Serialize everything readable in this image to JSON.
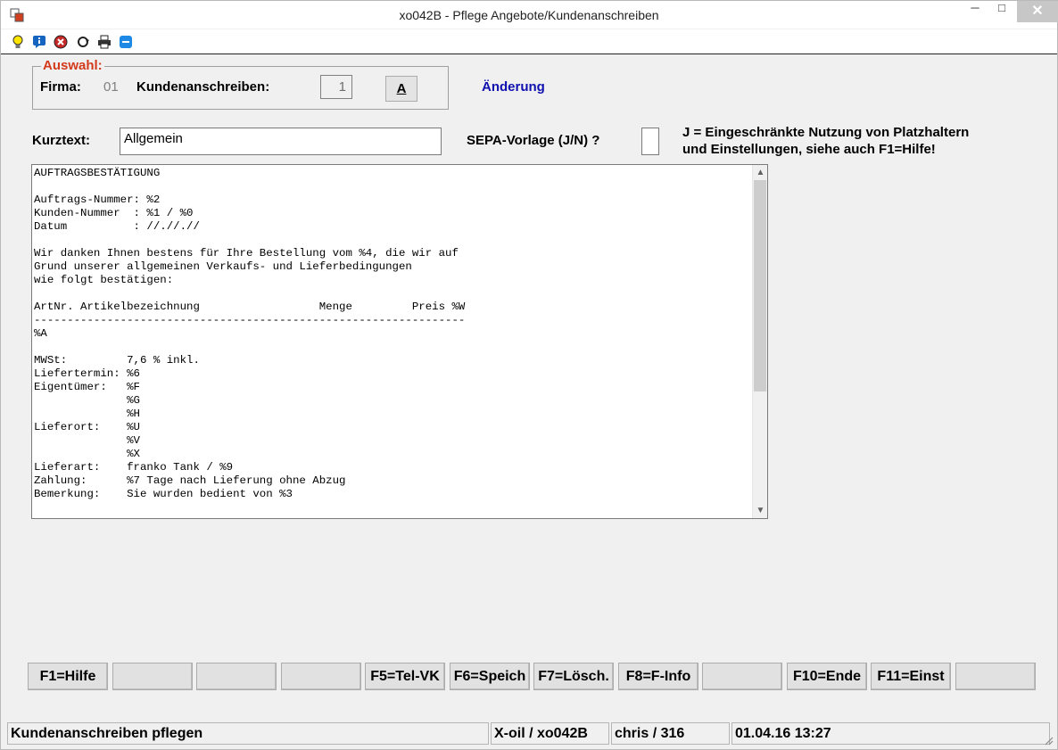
{
  "window": {
    "title": "xo042B - Pflege Angebote/Kundenanschreiben",
    "minimize_glyph": "─",
    "maximize_glyph": "□",
    "close_glyph": "✕"
  },
  "toolbar_icons": [
    "lightbulb-icon",
    "info-icon",
    "cancel-icon",
    "refresh-icon",
    "print-icon",
    "minus-icon"
  ],
  "selection": {
    "legend": "Auswahl:",
    "firma_label": "Firma:",
    "firma_value": "01",
    "kundenanschreiben_label": "Kundenanschreiben:",
    "kundenanschreiben_value": "1",
    "a_button": "A",
    "mode": "Änderung"
  },
  "form": {
    "kurztext_label": "Kurztext:",
    "kurztext_value": "Allgemein",
    "sepa_label": "SEPA-Vorlage (J/N) ?",
    "sepa_value": "",
    "note_line1": "J = Eingeschränkte Nutzung von Platzhaltern",
    "note_line2": "und Einstellungen, siehe auch F1=Hilfe!"
  },
  "letter_text": "AUFTRAGSBESTÄTIGUNG\n\nAuftrags-Nummer: %2\nKunden-Nummer  : %1 / %0\nDatum          : //.//.//\n\nWir danken Ihnen bestens für Ihre Bestellung vom %4, die wir auf\nGrund unserer allgemeinen Verkaufs- und Lieferbedingungen\nwie folgt bestätigen:\n\nArtNr. Artikelbezeichnung                  Menge         Preis %W\n-----------------------------------------------------------------\n%A\n\nMWSt:         7,6 % inkl.\nLiefertermin: %6\nEigentümer:   %F\n              %G\n              %H\nLieferort:    %U\n              %V\n              %X\nLieferart:    franko Tank / %9\nZahlung:      %7 Tage nach Lieferung ohne Abzug\nBemerkung:    Sie wurden bedient von %3",
  "function_keys": [
    {
      "label": "F1=Hilfe"
    },
    {
      "label": ""
    },
    {
      "label": ""
    },
    {
      "label": ""
    },
    {
      "label": "F5=Tel-VK"
    },
    {
      "label": "F6=Speich"
    },
    {
      "label": "F7=Lösch."
    },
    {
      "label": "F8=F-Info"
    },
    {
      "label": ""
    },
    {
      "label": "F10=Ende"
    },
    {
      "label": "F11=Einst"
    },
    {
      "label": ""
    }
  ],
  "statusbar": {
    "message": "Kundenanschreiben pflegen",
    "program": "X-oil / xo042B",
    "user": "chris / 316",
    "datetime": "01.04.16 13:27"
  }
}
